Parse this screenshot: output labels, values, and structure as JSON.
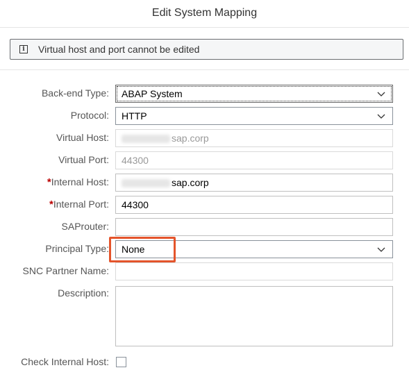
{
  "dialog": {
    "title": "Edit System Mapping"
  },
  "info": {
    "icon": "info-icon",
    "text": "Virtual host and port cannot be edited"
  },
  "form": {
    "backend_type": {
      "label": "Back-end Type:",
      "value": "ABAP System"
    },
    "protocol": {
      "label": "Protocol:",
      "value": "HTTP"
    },
    "virtual_host": {
      "label": "Virtual Host:",
      "value": "sap.corp"
    },
    "virtual_port": {
      "label": "Virtual Port:",
      "value": "44300"
    },
    "internal_host": {
      "required": "*",
      "label": "Internal Host:",
      "value": "sap.corp"
    },
    "internal_port": {
      "required": "*",
      "label": "Internal Port:",
      "value": "44300"
    },
    "saprouter": {
      "label": "SAProuter:",
      "value": ""
    },
    "principal_type": {
      "label": "Principal Type:",
      "value": "None"
    },
    "snc_partner_name": {
      "label": "SNC Partner Name:",
      "value": ""
    },
    "description": {
      "label": "Description:",
      "value": ""
    },
    "check_internal_host": {
      "label": "Check Internal Host:",
      "checked": false
    }
  },
  "colors": {
    "highlight": "#e4542b",
    "required": "#bb0000"
  }
}
